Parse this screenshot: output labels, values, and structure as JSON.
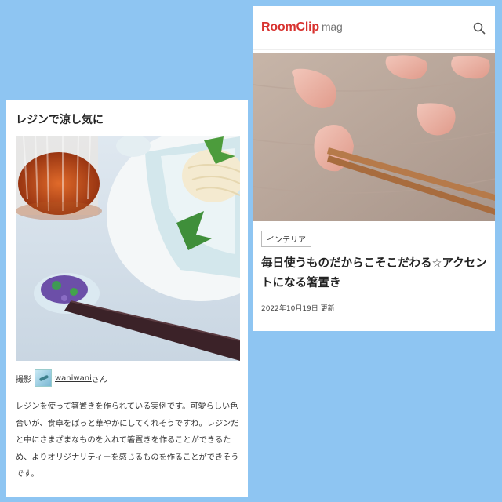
{
  "left_card": {
    "heading": "レジンで涼し気に",
    "credit": {
      "prefix": "撮影",
      "username": "waniwani",
      "suffix": "さん"
    },
    "body": "レジンを使って箸置きを作られている実例です。可愛らしい色合いが、食卓をぱっと華やかにしてくれそうですね。レジンだと中にさまざまなものを入れて箸置きを作ることができるため、よりオリジナリティーを感じるものを作ることができそうです。"
  },
  "right_card": {
    "logo": {
      "main": "RoomClip",
      "sub": "mag"
    },
    "tag": "インテリア",
    "title": "毎日使うものだからこそこだわる☆アクセントになる箸置き",
    "date": "2022年10月19日 更新"
  },
  "colors": {
    "background": "#8ec5f2",
    "logo": "#d8322f"
  }
}
